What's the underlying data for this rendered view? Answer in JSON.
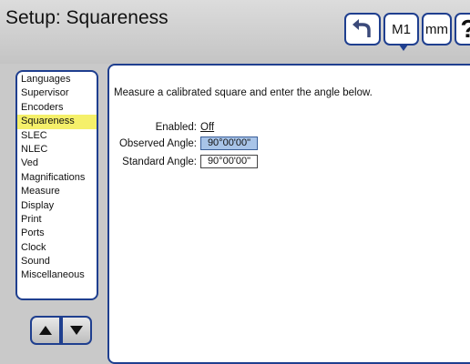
{
  "header": {
    "title": "Setup: Squareness",
    "buttons": {
      "undo_icon": "undo-arrow-icon",
      "m1": "M1",
      "mm": "mm",
      "help": "?"
    }
  },
  "sidebar": {
    "items": [
      {
        "label": "Languages"
      },
      {
        "label": "Supervisor"
      },
      {
        "label": "Encoders"
      },
      {
        "label": "Squareness",
        "active": true
      },
      {
        "label": "SLEC"
      },
      {
        "label": "NLEC"
      },
      {
        "label": "Ved"
      },
      {
        "label": "Magnifications"
      },
      {
        "label": "Measure"
      },
      {
        "label": "Display"
      },
      {
        "label": "Print"
      },
      {
        "label": "Ports"
      },
      {
        "label": "Clock"
      },
      {
        "label": "Sound"
      },
      {
        "label": "Miscellaneous"
      }
    ]
  },
  "nav": {
    "up_icon": "triangle-up-icon",
    "down_icon": "triangle-down-icon"
  },
  "main": {
    "instruction": "Measure a calibrated square and enter the angle below.",
    "enabled": {
      "label": "Enabled:",
      "value": "Off"
    },
    "observed": {
      "label": "Observed Angle:",
      "value": "90°00'00\""
    },
    "standard": {
      "label": "Standard Angle:",
      "value": "90°00'00\""
    }
  },
  "colors": {
    "accent": "#1f3f8f",
    "selected": "#f5f06a",
    "field_highlight": "#a8c4e8"
  }
}
